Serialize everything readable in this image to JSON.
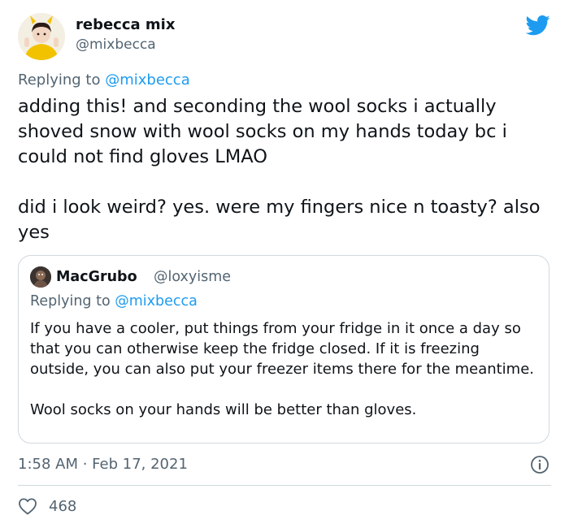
{
  "author": {
    "name": "rebecca mix",
    "handle": "@mixbecca"
  },
  "reply": {
    "prefix": "Replying to",
    "handle": "@mixbecca"
  },
  "tweet_text": "adding this! and seconding the wool socks i actually shoved snow with wool socks on my hands today bc i could not find gloves LMAO\n\ndid i look weird? yes. were my fingers nice n toasty? also yes",
  "quote": {
    "name": "MacGrubo",
    "handle": "@loxyisme",
    "reply_prefix": "Replying to",
    "reply_handle": "@mixbecca",
    "text": "If you have a cooler, put things from your fridge in it once a day so that you can otherwise keep the fridge closed. If it is freezing outside, you can also put your freezer items there for the meantime.\n\nWool socks on your hands will be better than gloves."
  },
  "timestamp": "1:58 AM · Feb 17, 2021",
  "likes": "468",
  "colors": {
    "accent": "#1d9bf0",
    "secondary_text": "#536471",
    "border": "#cfd9de"
  },
  "icons": [
    "twitter-logo-icon",
    "info-icon",
    "heart-icon"
  ]
}
